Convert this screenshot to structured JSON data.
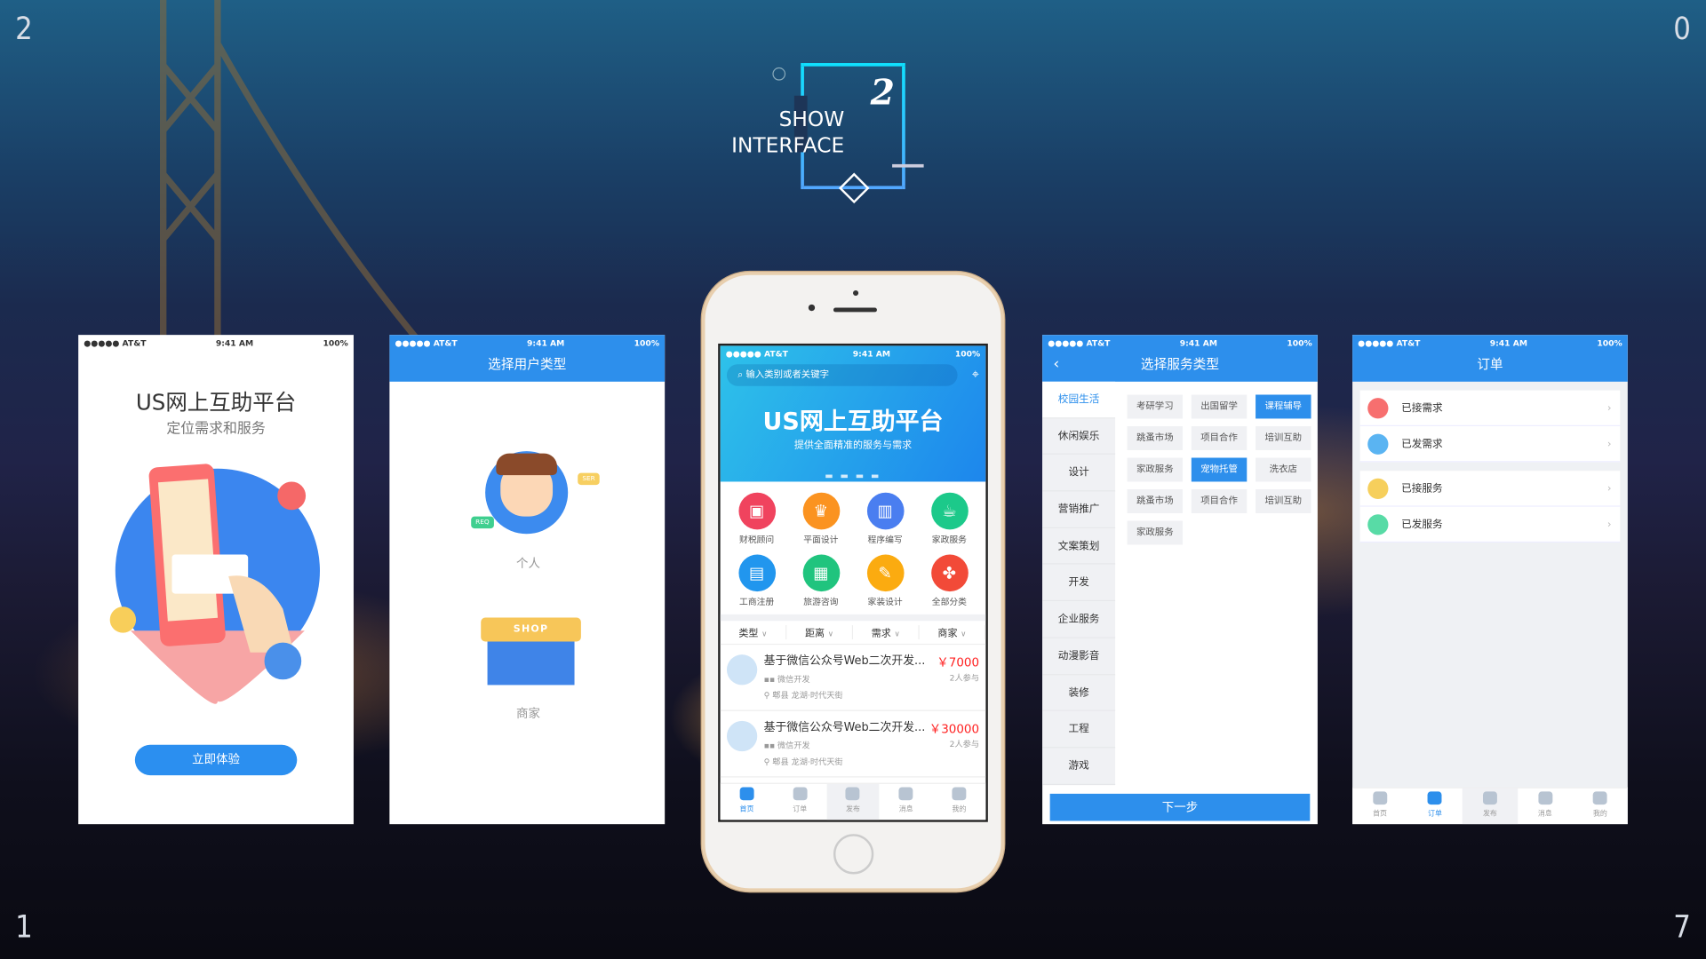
{
  "corners": [
    "2",
    "0",
    "1",
    "7"
  ],
  "hero": {
    "number": "2",
    "line1": "SHOW",
    "line2": "INTERFACE"
  },
  "status": {
    "carrier": "●●●●● AT&T",
    "time": "9:41 AM",
    "battery": "100%"
  },
  "screen1": {
    "title": "US网上互助平台",
    "subtitle": "定位需求和服务",
    "button": "立即体验"
  },
  "screen2": {
    "nav_title": "选择用户类型",
    "option_personal": "个人",
    "option_merchant": "商家",
    "badge_ser": "SER",
    "badge_req": "REQ",
    "badge_shop": "SHOP"
  },
  "home": {
    "search_placeholder": "输入类别或者关键字",
    "banner_title": "US网上互助平台",
    "banner_subtitle": "提供全面精准的服务与需求",
    "categories": [
      {
        "label": "财税顾问",
        "color": "#f0435e",
        "icon": "briefcase-icon"
      },
      {
        "label": "平面设计",
        "color": "#fb9320",
        "icon": "crown-icon"
      },
      {
        "label": "程序编写",
        "color": "#4a7ef0",
        "icon": "chart-icon"
      },
      {
        "label": "家政服务",
        "color": "#1cc98a",
        "icon": "cup-icon"
      },
      {
        "label": "工商注册",
        "color": "#2196ee",
        "icon": "factory-icon"
      },
      {
        "label": "旅游咨询",
        "color": "#20c47e",
        "icon": "building-icon"
      },
      {
        "label": "家装设计",
        "color": "#fbab10",
        "icon": "paint-roller-icon"
      },
      {
        "label": "全部分类",
        "color": "#f24a38",
        "icon": "grid-icon"
      }
    ],
    "filters": [
      "类型",
      "距离",
      "需求",
      "商家"
    ],
    "items": [
      {
        "title": "基于微信公众号Web二次开发...",
        "price": "￥7000",
        "tag": "微信开发",
        "location": "郫县 龙湖·时代天街",
        "participants": "2人参与"
      },
      {
        "title": "基于微信公众号Web二次开发...",
        "price": "￥30000",
        "tag": "微信开发",
        "location": "郫县 龙湖·时代天街",
        "participants": "2人参与"
      }
    ]
  },
  "tabs": [
    "首页",
    "订单",
    "发布",
    "消息",
    "我的"
  ],
  "screen4": {
    "nav_title": "选择服务类型",
    "side": [
      "校园生活",
      "休闲娱乐",
      "设计",
      "营销推广",
      "文案策划",
      "开发",
      "企业服务",
      "动漫影音",
      "装修",
      "工程",
      "游戏"
    ],
    "chips": [
      {
        "label": "考研学习",
        "selected": false
      },
      {
        "label": "出国留学",
        "selected": false
      },
      {
        "label": "课程辅导",
        "selected": true
      },
      {
        "label": "跳蚤市场",
        "selected": false
      },
      {
        "label": "项目合作",
        "selected": false
      },
      {
        "label": "培训互助",
        "selected": false
      },
      {
        "label": "家政服务",
        "selected": false
      },
      {
        "label": "宠物托管",
        "selected": true
      },
      {
        "label": "洗衣店",
        "selected": false
      },
      {
        "label": "跳蚤市场",
        "selected": false
      },
      {
        "label": "项目合作",
        "selected": false
      },
      {
        "label": "培训互助",
        "selected": false
      },
      {
        "label": "家政服务",
        "selected": false
      }
    ],
    "next": "下一步"
  },
  "screen5": {
    "nav_title": "订单",
    "groups": [
      [
        {
          "label": "已接需求",
          "color": "#f76f6f"
        },
        {
          "label": "已发需求",
          "color": "#5ab4f2"
        }
      ],
      [
        {
          "label": "已接服务",
          "color": "#f6cf5c"
        },
        {
          "label": "已发服务",
          "color": "#58dba6"
        }
      ]
    ]
  },
  "colors": {
    "primary": "#2d8fec",
    "price": "#ff2222"
  }
}
